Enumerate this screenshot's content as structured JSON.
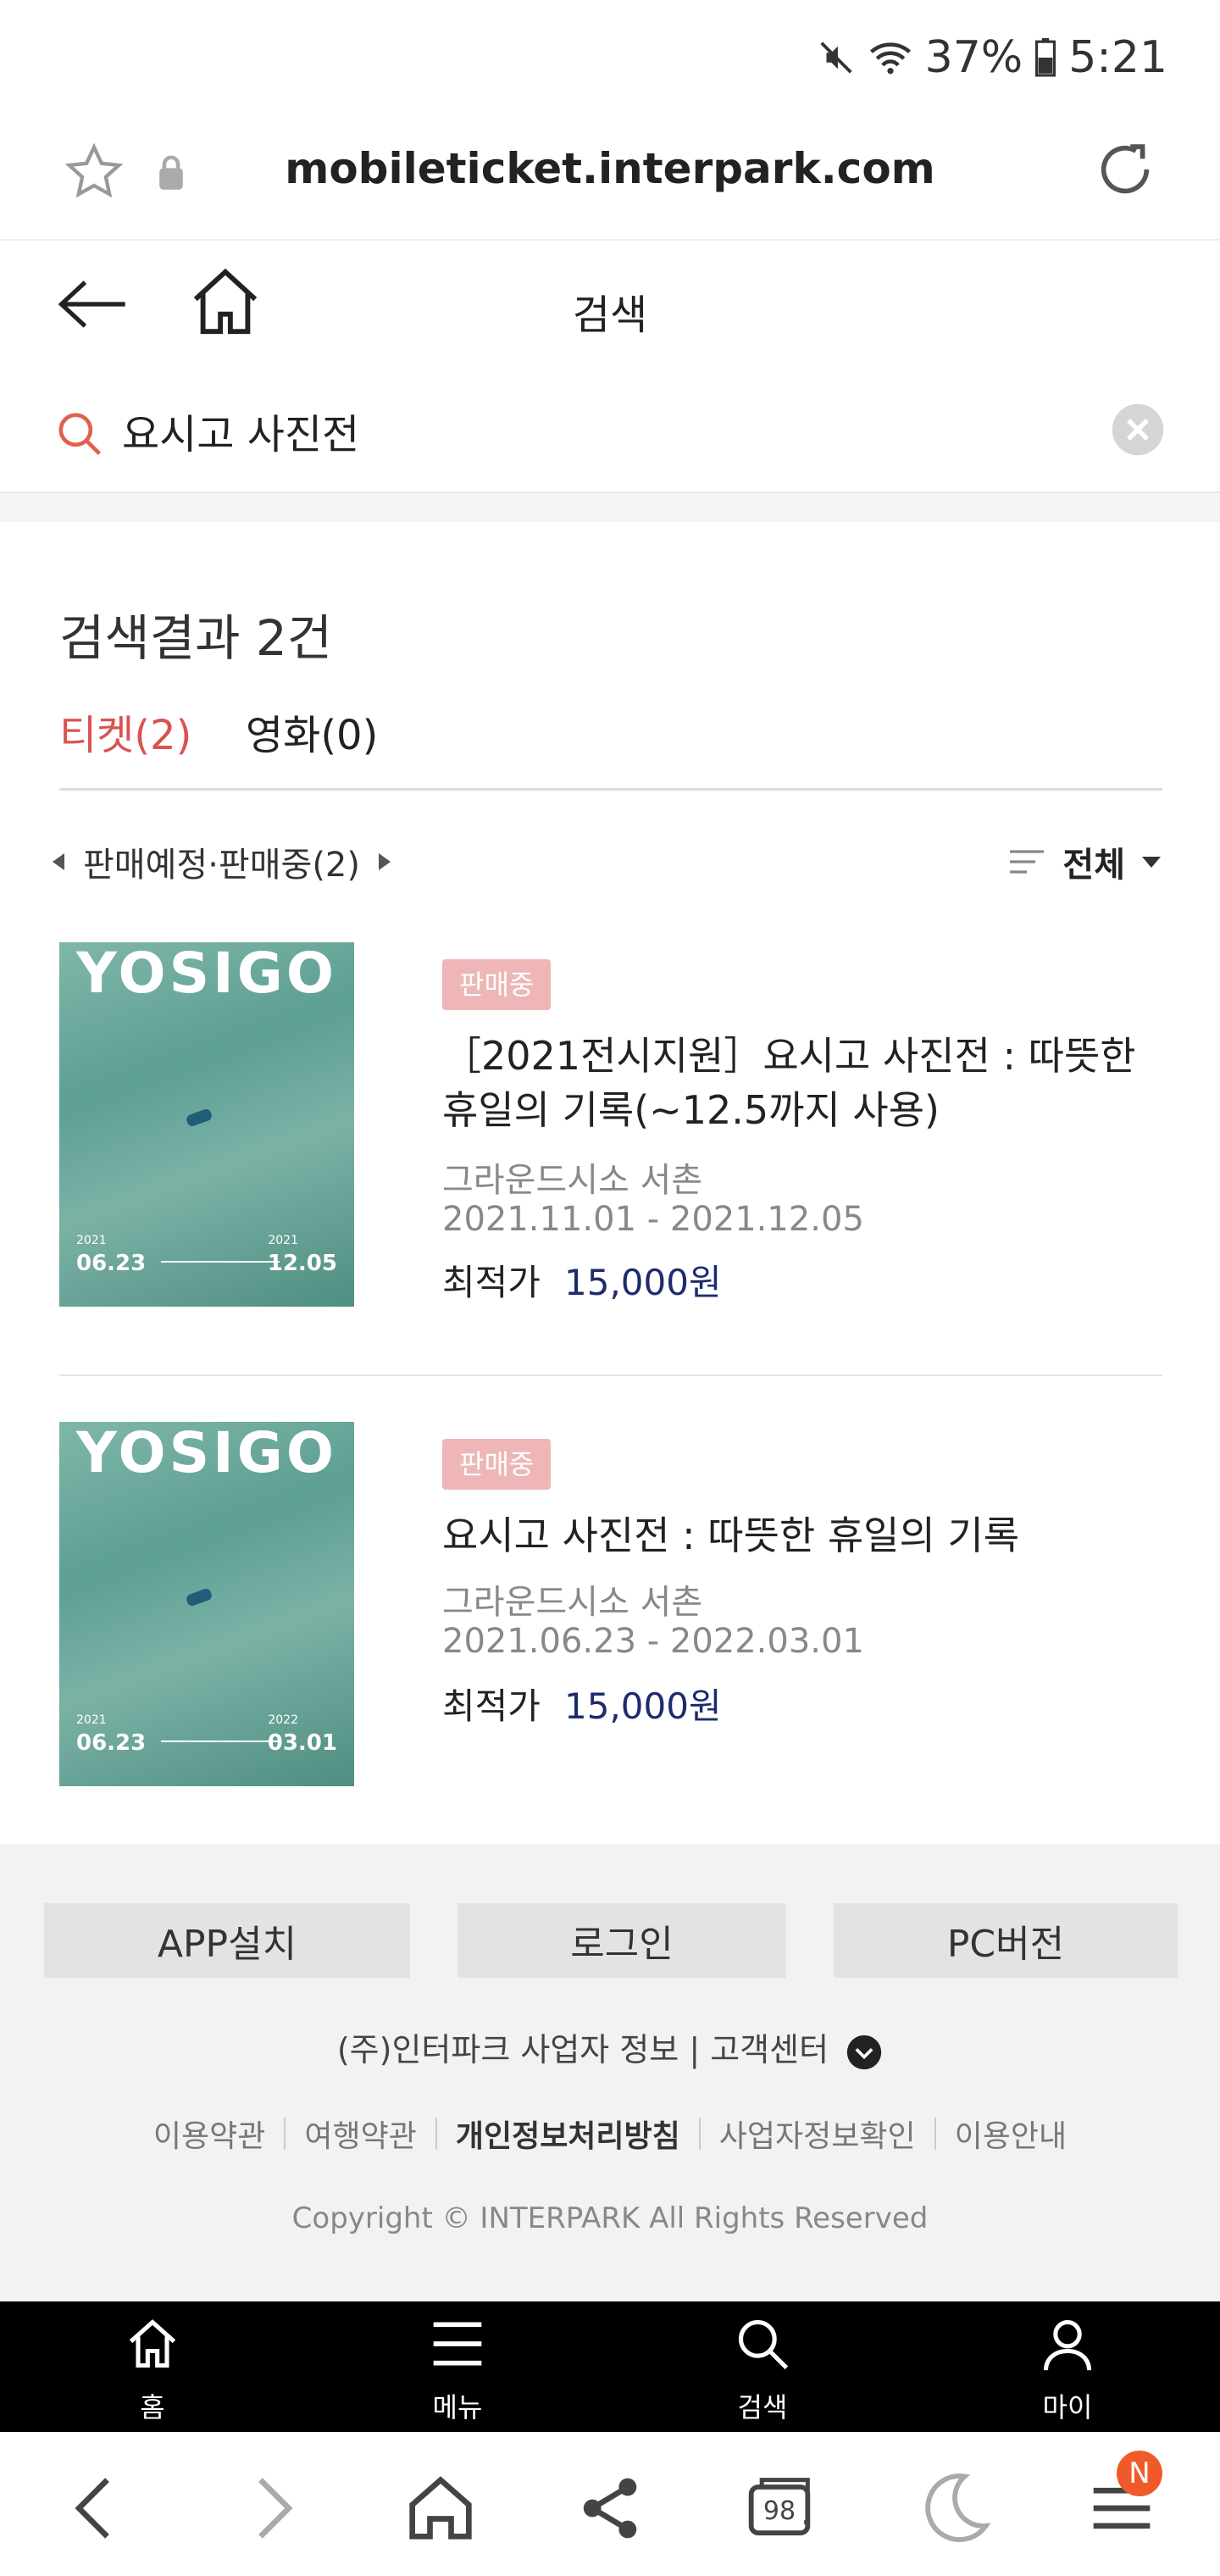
{
  "status": {
    "battery": "37%",
    "time": "5:21"
  },
  "browser": {
    "url": "mobileticket.interpark.com"
  },
  "header": {
    "title": "검색"
  },
  "search": {
    "query": "요시고 사진전",
    "placeholder": ""
  },
  "results": {
    "count_label": "검색결과 2건",
    "tabs": [
      {
        "label": "티켓(2)",
        "active": true
      },
      {
        "label": "영화(0)",
        "active": false
      }
    ],
    "filter_label": "판매예정·판매중(2)",
    "sort_label": "전체",
    "items": [
      {
        "badge": "판매중",
        "title": "［2021전시지원］요시고 사진전 : 따뜻한 휴일의 기록(~12.5까지 사용)",
        "venue": "그라운드시소 서촌",
        "dates": "2021.11.01 - 2021.12.05",
        "price_label": "최적가",
        "price": "15,000원",
        "poster": {
          "title": "YOSIGO",
          "year_start": "2021",
          "date_start": "06.23",
          "year_end": "2021",
          "date_end": "12.05"
        }
      },
      {
        "badge": "판매중",
        "title": "요시고 사진전 : 따뜻한 휴일의 기록",
        "venue": "그라운드시소 서촌",
        "dates": "2021.06.23 - 2022.03.01",
        "price_label": "최적가",
        "price": "15,000원",
        "poster": {
          "title": "YOSIGO",
          "year_start": "2021",
          "date_start": "06.23",
          "year_end": "2022",
          "date_end": "03.01"
        }
      }
    ]
  },
  "footer": {
    "buttons": [
      "APP설치",
      "로그인",
      "PC버전"
    ],
    "info": "(주)인터파크 사업자 정보 | 고객센터",
    "links": [
      "이용약관",
      "여행약관",
      "개인정보처리방침",
      "사업자정보확인",
      "이용안내"
    ],
    "copyright": "Copyright © INTERPARK All Rights Reserved"
  },
  "bottom_nav": [
    {
      "label": "홈",
      "icon": "home-icon"
    },
    {
      "label": "메뉴",
      "icon": "menu-icon"
    },
    {
      "label": "검색",
      "icon": "search-icon"
    },
    {
      "label": "마이",
      "icon": "user-icon"
    }
  ],
  "browser_bar": {
    "tabs_count": "98",
    "notification_badge": "N"
  },
  "colors": {
    "accent": "#d9534f",
    "price": "#1e2b6e",
    "badge": "#eeb6b6",
    "nav_bg": "#000000"
  }
}
